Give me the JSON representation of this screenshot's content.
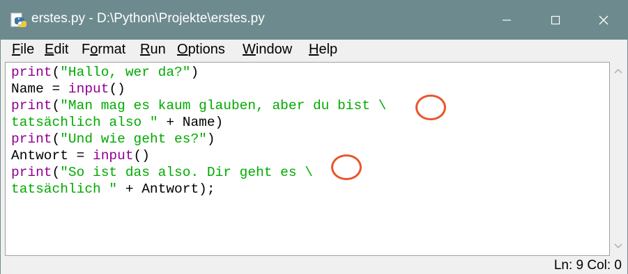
{
  "window": {
    "title": "erstes.py - D:\\Python\\Projekte\\erstes.py",
    "icon": "python-file-icon",
    "controls": [
      "minimize-icon",
      "maximize-icon",
      "close-icon"
    ]
  },
  "menu": {
    "items": [
      {
        "label": "File",
        "key": "F"
      },
      {
        "label": "Edit",
        "key": "E"
      },
      {
        "label": "Format",
        "key": "o"
      },
      {
        "label": "Run",
        "key": "R"
      },
      {
        "label": "Options",
        "key": "O"
      },
      {
        "label": "Window",
        "key": "W"
      },
      {
        "label": "Help",
        "key": "H"
      }
    ]
  },
  "editor": {
    "lines": [
      [
        {
          "t": "print",
          "c": "kw"
        },
        {
          "t": "(",
          "c": ""
        },
        {
          "t": "\"Hallo, wer da?\"",
          "c": "str"
        },
        {
          "t": ")",
          "c": ""
        }
      ],
      [
        {
          "t": "Name = ",
          "c": ""
        },
        {
          "t": "input",
          "c": "kw"
        },
        {
          "t": "()",
          "c": ""
        }
      ],
      [
        {
          "t": "print",
          "c": "kw"
        },
        {
          "t": "(",
          "c": ""
        },
        {
          "t": "\"Man mag es kaum glauben, aber du bist \\",
          "c": "str"
        }
      ],
      [
        {
          "t": "tatsächlich also \"",
          "c": "str"
        },
        {
          "t": " + Name)",
          "c": ""
        }
      ],
      [
        {
          "t": "print",
          "c": "kw"
        },
        {
          "t": "(",
          "c": ""
        },
        {
          "t": "\"Und wie geht es?\"",
          "c": "str"
        },
        {
          "t": ")",
          "c": ""
        }
      ],
      [
        {
          "t": "Antwort = ",
          "c": ""
        },
        {
          "t": "input",
          "c": "kw"
        },
        {
          "t": "()",
          "c": ""
        }
      ],
      [
        {
          "t": "print",
          "c": "kw"
        },
        {
          "t": "(",
          "c": ""
        },
        {
          "t": "\"So ist das also. Dir geht es \\",
          "c": "str"
        }
      ],
      [
        {
          "t": "tatsächlich \"",
          "c": "str"
        },
        {
          "t": " + Antwort);",
          "c": ""
        }
      ]
    ],
    "colors": {
      "keyword": "#900090",
      "string": "#00aa00",
      "annotation": "#e8552b"
    }
  },
  "status": {
    "text": "Ln: 9  Col: 0"
  }
}
